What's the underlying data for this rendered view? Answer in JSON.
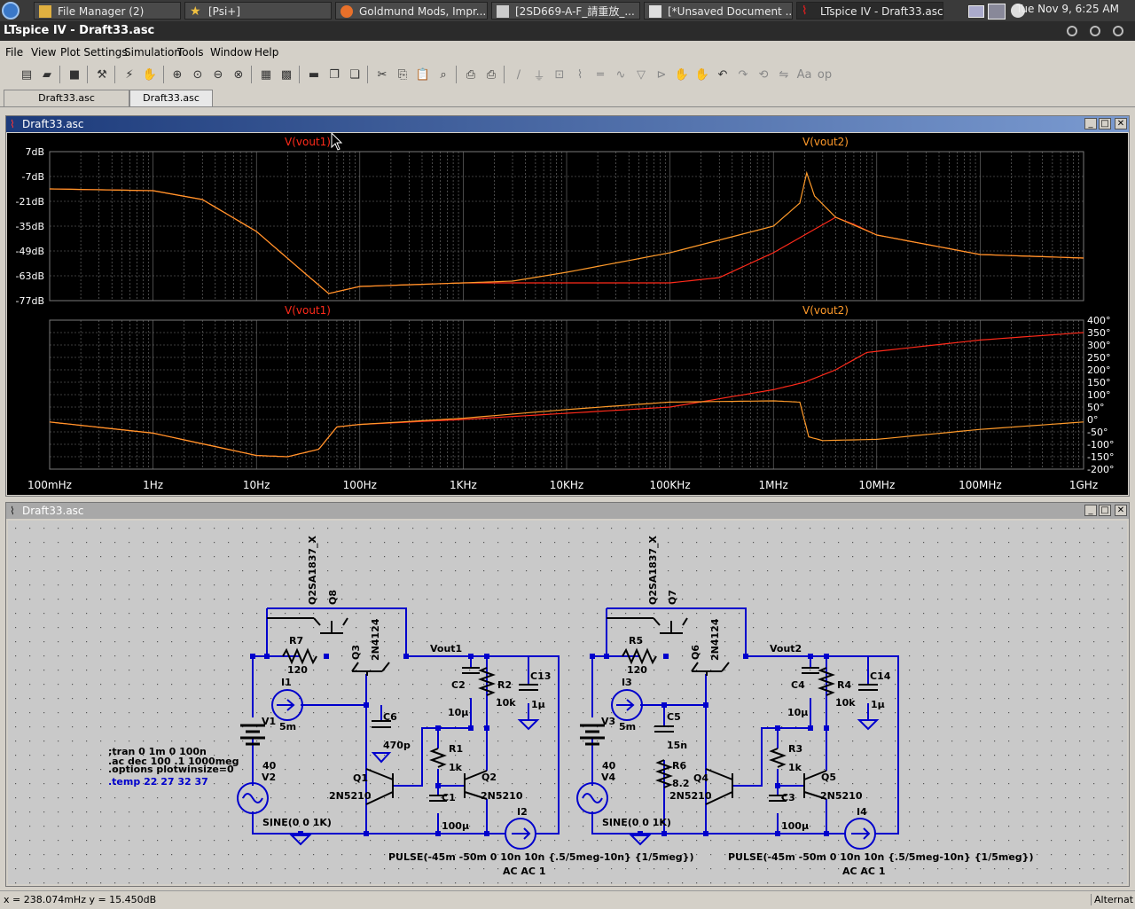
{
  "taskbar": {
    "tasks": [
      {
        "label": "File Manager (2)"
      },
      {
        "label": "[Psi+]"
      },
      {
        "label": "Goldmund Mods, Impr..."
      },
      {
        "label": "[2SD669-A-F_請重放_..."
      },
      {
        "label": "[*Unsaved Document ..."
      },
      {
        "label": "LTspice IV - Draft33.asc"
      }
    ],
    "clock": "Tue Nov  9,  6:25 AM"
  },
  "app_title": "LTspice IV - Draft33.asc",
  "menu": [
    "File",
    "View",
    "Plot Settings",
    "Simulation",
    "Tools",
    "Window",
    "Help"
  ],
  "doc_tabs": [
    "Draft33.asc",
    "Draft33.asc"
  ],
  "plot_window": {
    "title": "Draft33.asc",
    "trace1_label": "V(vout1)",
    "trace2_label": "V(vout2)",
    "colors": {
      "vout1": "#ff2a1a",
      "vout2": "#ff9a2a",
      "grid": "#7a7a7a",
      "bg": "#000000"
    }
  },
  "chart_data": {
    "type": "line",
    "x_scale": "log",
    "x_ticks": [
      "100mHz",
      "1Hz",
      "10Hz",
      "100Hz",
      "1KHz",
      "10KHz",
      "100KHz",
      "1MHz",
      "10MHz",
      "100MHz",
      "1GHz"
    ],
    "panes": [
      {
        "quantity": "magnitude",
        "y_ticks": [
          "7dB",
          "-7dB",
          "-21dB",
          "-35dB",
          "-49dB",
          "-63dB",
          "-77dB"
        ],
        "ylim": [
          -77,
          7
        ],
        "series": [
          {
            "name": "V(vout1)",
            "points": [
              [
                0.1,
                -14
              ],
              [
                1,
                -15
              ],
              [
                3,
                -20
              ],
              [
                10,
                -38
              ],
              [
                30,
                -62
              ],
              [
                50,
                -73
              ],
              [
                100,
                -69
              ],
              [
                1000,
                -67
              ],
              [
                10000,
                -67
              ],
              [
                100000,
                -67
              ],
              [
                300000,
                -64
              ],
              [
                1000000,
                -50
              ],
              [
                2000000,
                -40
              ],
              [
                4000000,
                -30
              ],
              [
                6000000,
                -34
              ],
              [
                10000000,
                -40
              ],
              [
                100000000,
                -51
              ],
              [
                1000000000,
                -53
              ]
            ]
          },
          {
            "name": "V(vout2)",
            "points": [
              [
                0.1,
                -14
              ],
              [
                1,
                -15
              ],
              [
                3,
                -20
              ],
              [
                10,
                -38
              ],
              [
                30,
                -62
              ],
              [
                50,
                -73
              ],
              [
                100,
                -69
              ],
              [
                1000,
                -67
              ],
              [
                3000,
                -66
              ],
              [
                10000,
                -61
              ],
              [
                100000,
                -50
              ],
              [
                1000000,
                -35
              ],
              [
                1800000,
                -22
              ],
              [
                2100000,
                -5
              ],
              [
                2500000,
                -18
              ],
              [
                4000000,
                -30
              ],
              [
                10000000,
                -40
              ],
              [
                100000000,
                -51
              ],
              [
                1000000000,
                -53
              ]
            ]
          }
        ]
      },
      {
        "quantity": "phase",
        "y_ticks": [
          "400°",
          "350°",
          "300°",
          "250°",
          "200°",
          "150°",
          "100°",
          "50°",
          "0°",
          "-50°",
          "-100°",
          "-150°",
          "-200°"
        ],
        "ylim": [
          -200,
          400
        ],
        "series": [
          {
            "name": "V(vout1)",
            "points": [
              [
                0.1,
                -10
              ],
              [
                1,
                -55
              ],
              [
                10,
                -145
              ],
              [
                20,
                -150
              ],
              [
                40,
                -120
              ],
              [
                60,
                -30
              ],
              [
                100,
                -20
              ],
              [
                1000,
                0
              ],
              [
                10000,
                25
              ],
              [
                100000,
                50
              ],
              [
                1000000,
                120
              ],
              [
                2000000,
                150
              ],
              [
                4000000,
                200
              ],
              [
                8000000,
                270
              ],
              [
                100000000,
                320
              ],
              [
                1000000000,
                350
              ]
            ]
          },
          {
            "name": "V(vout2)",
            "points": [
              [
                0.1,
                -10
              ],
              [
                1,
                -55
              ],
              [
                10,
                -145
              ],
              [
                20,
                -150
              ],
              [
                40,
                -120
              ],
              [
                60,
                -30
              ],
              [
                100,
                -20
              ],
              [
                1000,
                5
              ],
              [
                10000,
                40
              ],
              [
                100000,
                70
              ],
              [
                1000000,
                75
              ],
              [
                1800000,
                70
              ],
              [
                2200000,
                -70
              ],
              [
                3000000,
                -85
              ],
              [
                10000000,
                -80
              ],
              [
                100000000,
                -40
              ],
              [
                1000000000,
                -10
              ]
            ]
          }
        ]
      }
    ]
  },
  "schematic_window": {
    "title": "Draft33.asc",
    "directives": [
      ";tran 0 1m 0 100n",
      ".ac dec 100 .1 1000meg",
      ".options plotwinsize=0",
      ".temp 22 27 32 37"
    ],
    "labels": {
      "q8": "Q8",
      "q8_model": "Q2SA1837_X",
      "q7": "Q7",
      "q7_model": "Q2SA1837_X",
      "r7": "R7",
      "r7_val": "120",
      "r5": "R5",
      "r5_val": "120",
      "q3": "Q3",
      "q3_model": "2N4124",
      "q6": "Q6",
      "q6_model": "2N4124",
      "vout1": "Vout1",
      "vout2": "Vout2",
      "i1": "I1",
      "i1_val": "5m",
      "i3": "I3",
      "i3_val": "5m",
      "v1": "V1",
      "v1_val": "40",
      "v2": "V2",
      "v3": "V3",
      "v3_val": "40",
      "v4": "V4",
      "c6": "C6",
      "c6_val": "470p",
      "c5": "C5",
      "c5_val": "15n",
      "r6": "R6",
      "r6_val": "8.2",
      "c2": "C2",
      "c2_val": "10µ",
      "c4": "C4",
      "c4_val": "10µ",
      "r2": "R2",
      "r2_val": "10k",
      "r4": "R4",
      "r4_val": "10k",
      "c13": "C13",
      "c13_val": "1µ",
      "c14": "C14",
      "c14_val": "1µ",
      "r1": "R1",
      "r1_val": "1k",
      "r3": "R3",
      "r3_val": "1k",
      "q1": "Q1",
      "q1_model": "2N5210",
      "q2": "Q2",
      "q2_model": "2N5210",
      "q4": "Q4",
      "q4_model": "2N5210",
      "q5": "Q5",
      "q5_model": "2N5210",
      "c1": "C1",
      "c1_val": "100µ",
      "c3": "C3",
      "c3_val": "100µ",
      "i2": "I2",
      "i4": "I4",
      "sine1": "SINE(0 0 1K)",
      "sine2": "SINE(0 0 1K)",
      "pulse1": "PULSE(-45m -50m 0 10n 10n {.5/5meg-10n} {1/5meg})",
      "ac1": "AC AC 1",
      "pulse2": "PULSE(-45m -50m 0 10n 10n {.5/5meg-10n} {1/5meg})",
      "ac2": "AC AC 1"
    },
    "colors": {
      "wire": "#0000cc",
      "component": "#000000",
      "directive_blue": "#0000cc",
      "bg": "#c9c9c9"
    }
  },
  "status": {
    "coords": "x = 238.074mHz    y = 15.450dB",
    "right": "Alternat"
  }
}
